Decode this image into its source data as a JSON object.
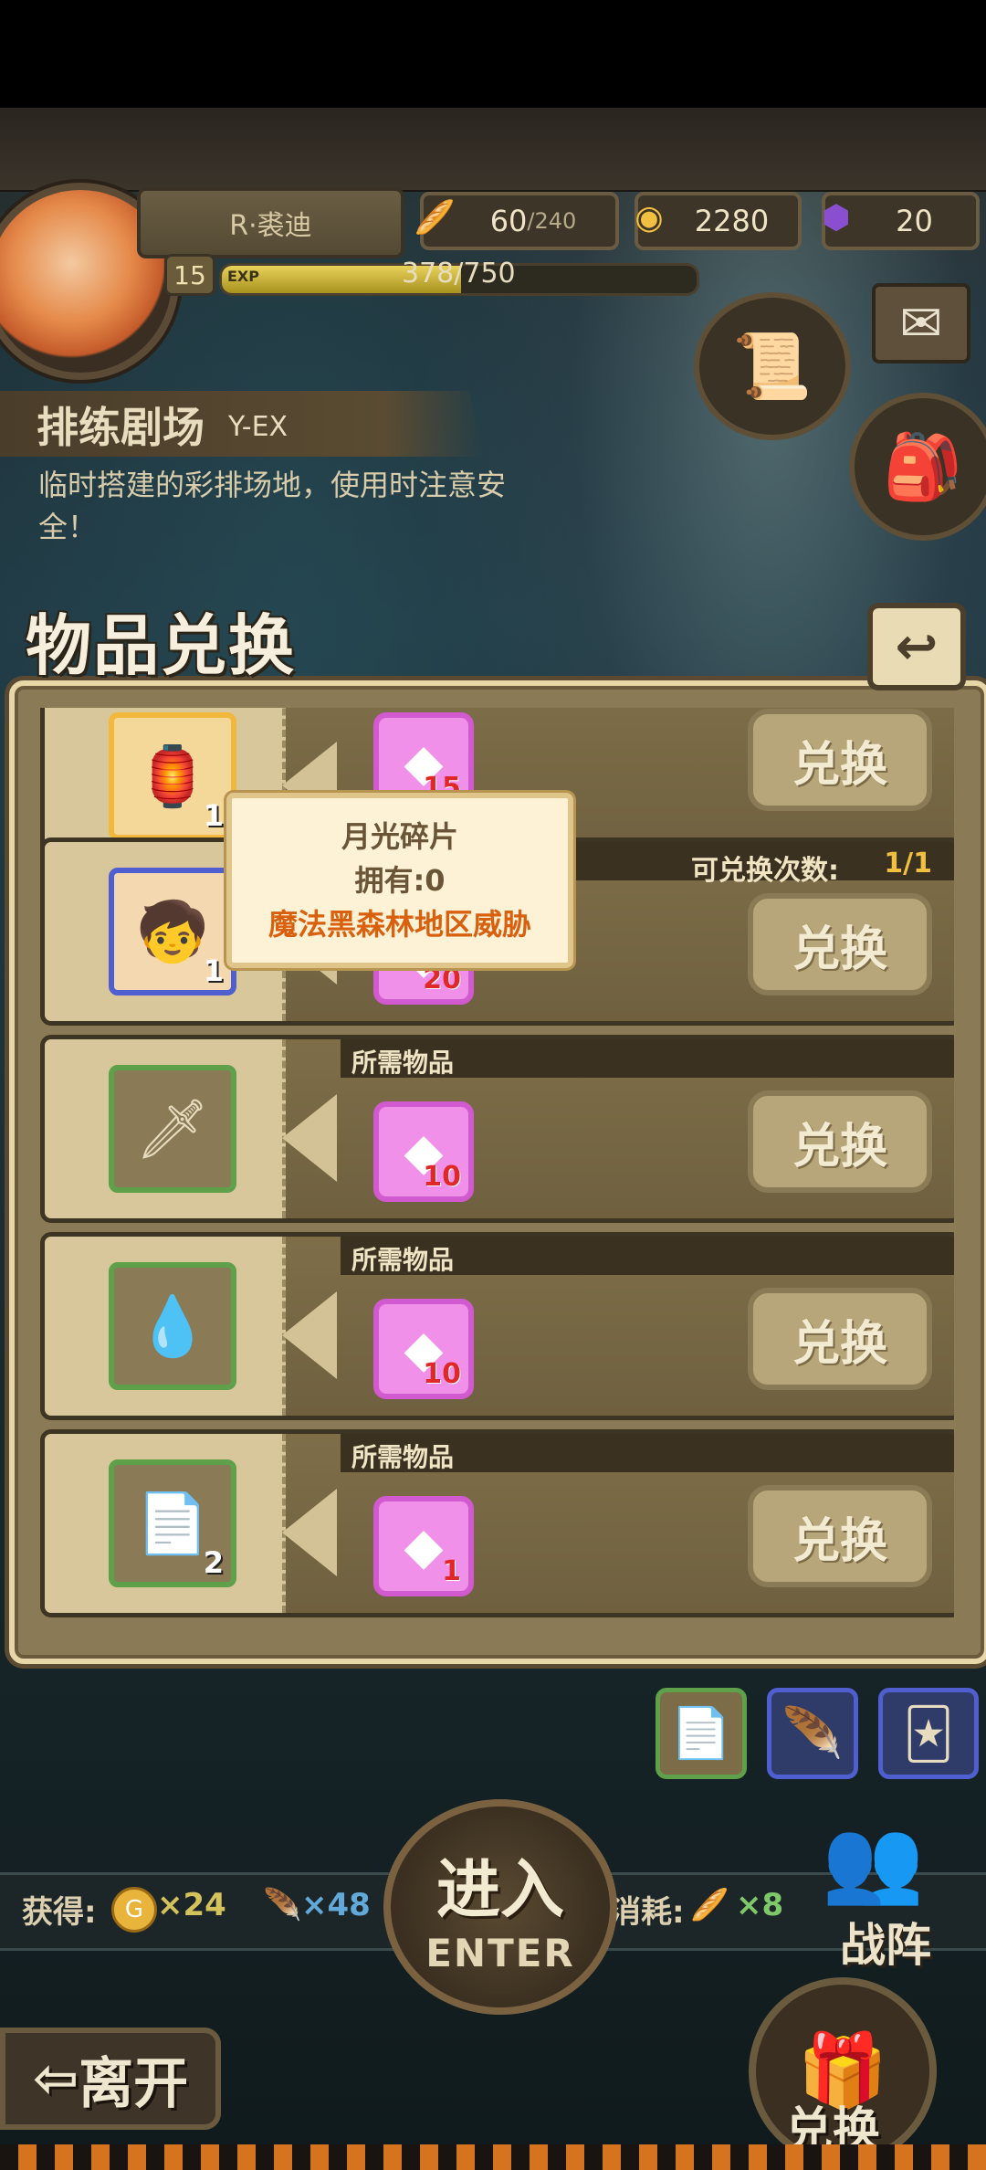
{
  "player": {
    "name": "R·裘迪",
    "level": "15",
    "exp_label": "EXP",
    "exp_text": "378/750",
    "exp_fraction": 0.504
  },
  "resources": {
    "stamina_current": "60",
    "stamina_max": "/240",
    "gold": "2280",
    "gems": "20"
  },
  "stage": {
    "title": "排练剧场",
    "subtitle": "Y-EX",
    "description": "临时搭建的彩排场地，使用时注意安全！"
  },
  "panel": {
    "title": "物品兑换",
    "back_icon": "back-arrow-icon"
  },
  "exchange_rows": [
    {
      "reward_icon": "lantern-icon",
      "reward_count": "1",
      "cost_icon": "moonlight-shard-icon",
      "cost_count": "15",
      "button": "兑换",
      "show_req": false
    },
    {
      "reward_icon": "character-card-icon",
      "reward_count": "1",
      "cost_icon": "moonlight-shard-icon",
      "cost_count": "20",
      "button": "兑换",
      "exchange_count_label": "可兑换次数:",
      "exchange_count_value": "1/1"
    },
    {
      "reward_icon": "sword-icon",
      "reward_count": "",
      "cost_icon": "moonlight-shard-icon",
      "cost_count": "10",
      "button": "兑换",
      "req_label": "所需物品"
    },
    {
      "reward_icon": "water-drops-icon",
      "reward_count": "",
      "cost_icon": "moonlight-shard-icon",
      "cost_count": "10",
      "button": "兑换",
      "req_label": "所需物品"
    },
    {
      "reward_icon": "paper-scrap-icon",
      "reward_count": "2",
      "cost_icon": "moonlight-shard-icon",
      "cost_count": "1",
      "button": "兑换",
      "req_label": "所需物品"
    }
  ],
  "tooltip": {
    "name": "月光碎片",
    "owned": "拥有:0",
    "region": "魔法黑森林地区威胁"
  },
  "bottom": {
    "gain_label": "获得:",
    "gold_reward": "×24",
    "feather_reward": "×48",
    "cost_label": "消耗:",
    "bread_cost": "×8",
    "enter_cn": "进入",
    "enter_en": "ENTER",
    "formation": "战阵",
    "leave": "离开",
    "exchange": "兑换"
  },
  "colors": {
    "accent_gold": "#f2c040",
    "tooltip_region": "#d8600e",
    "cost_border": "#d25ad0"
  }
}
